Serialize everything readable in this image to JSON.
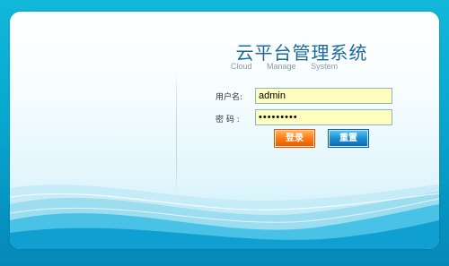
{
  "app": {
    "title": "云平台管理系统",
    "subtitle_words": [
      "Cloud",
      "Manage",
      "System"
    ]
  },
  "form": {
    "username_label": "用户名:",
    "username_value": "admin",
    "password_label": "密 码 :",
    "password_value": "•••••••••",
    "login_label": "登录",
    "reset_label": "重置"
  },
  "colors": {
    "background": "#08a7cf",
    "title": "#1a6a9e",
    "field_bg": "#fffdbe",
    "login_button": "#ff7a12",
    "reset_button": "#1d8fd2"
  }
}
